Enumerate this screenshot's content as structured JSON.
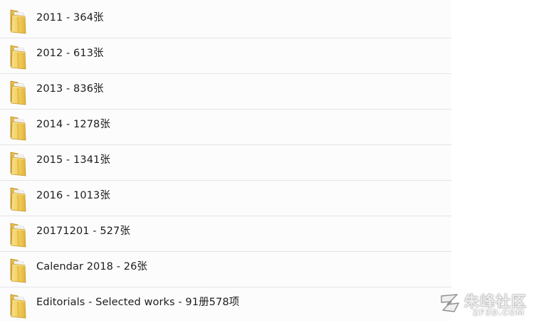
{
  "folders": [
    {
      "name": "2011 - 364张",
      "icon": "folder-icon"
    },
    {
      "name": "2012 - 613张",
      "icon": "folder-icon"
    },
    {
      "name": "2013 - 836张",
      "icon": "folder-icon"
    },
    {
      "name": "2014 - 1278张",
      "icon": "folder-icon"
    },
    {
      "name": "2015 - 1341张",
      "icon": "folder-icon"
    },
    {
      "name": "2016 - 1013张",
      "icon": "folder-icon"
    },
    {
      "name": "20171201 - 527张",
      "icon": "folder-icon"
    },
    {
      "name": "Calendar 2018 - 26张",
      "icon": "folder-icon"
    },
    {
      "name": "Editorials - Selected works - 91册578项",
      "icon": "folder-icon"
    }
  ],
  "watermark": {
    "text": "朱峰社区",
    "sub": "ZF3D.COM",
    "icon": "zf-logo-icon"
  },
  "colors": {
    "folder_front": "#f2d163",
    "folder_back": "#d8a92e",
    "row_divider": "#e4e4e4",
    "text": "#1c1c1c"
  }
}
